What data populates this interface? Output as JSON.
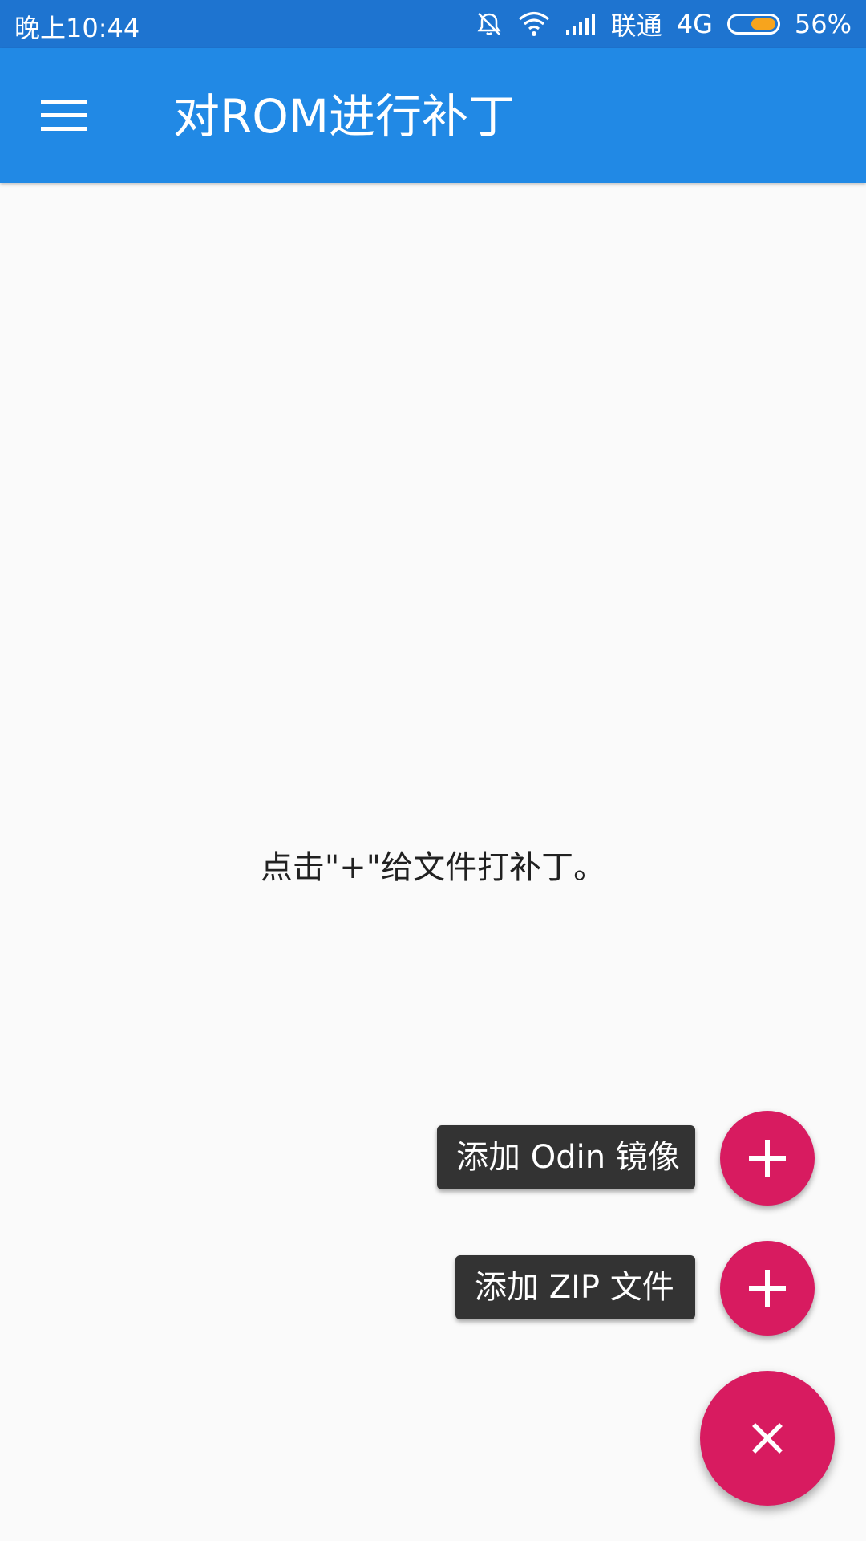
{
  "status_bar": {
    "time": "晚上10:44",
    "carrier": "联通",
    "network": "4G",
    "battery_percent": "56%",
    "battery_level": 0.56,
    "battery_color": "#F7A41D",
    "icons": [
      "alarm-off-icon",
      "wifi-icon",
      "signal-icon",
      "battery-icon"
    ]
  },
  "app_bar": {
    "title": "对ROM进行补丁",
    "menu_icon": "menu-icon",
    "background_color": "#2189E5"
  },
  "main": {
    "empty_message": "点击\"+\"给文件打补丁。"
  },
  "fab_menu": {
    "accent_color": "#D81B60",
    "items": [
      {
        "label": "添加 Odin 镜像",
        "icon": "plus-icon"
      },
      {
        "label": "添加 ZIP 文件",
        "icon": "plus-icon"
      }
    ],
    "main_icon": "close-icon"
  }
}
